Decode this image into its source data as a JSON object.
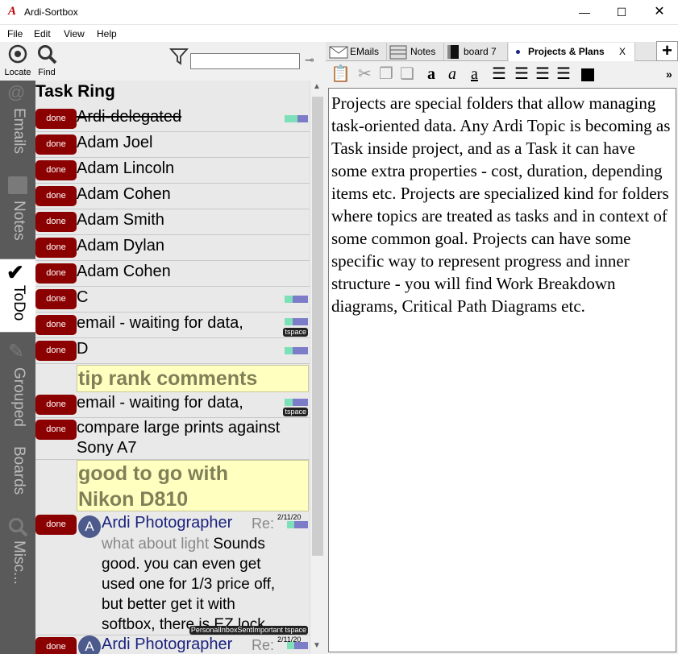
{
  "window": {
    "title": "Ardi-Sortbox",
    "minimize": "—",
    "maximize": "☐",
    "close": "✕"
  },
  "menu": [
    "File",
    "Edit",
    "View",
    "Help"
  ],
  "toolbar": {
    "locate": "Locate",
    "find": "Find",
    "filter_value": "",
    "pin": "⊸"
  },
  "side_tabs": [
    "Emails",
    "Notes",
    "ToDo",
    "Grouped",
    "Boards",
    "Misc..."
  ],
  "list": {
    "title": "Task Ring",
    "done_label": "done",
    "rows": [
      {
        "text": "Ardi-delegated",
        "progress": 0.55
      },
      {
        "text": "Adam Joel"
      },
      {
        "text": "Adam Lincoln"
      },
      {
        "text": "Adam Cohen"
      },
      {
        "text": "Adam Smith"
      },
      {
        "text": "Adam Dylan"
      },
      {
        "text": "Adam Cohen"
      },
      {
        "text": "C",
        "progress": 0.35
      },
      {
        "text": "email - waiting for data,",
        "progress": 0.35,
        "tag": "tspace"
      },
      {
        "text": "D",
        "progress": 0.35
      }
    ],
    "note1": "tip rank comments",
    "row_email2": {
      "text": "email - waiting for data,",
      "progress": 0.35,
      "tag": "tspace"
    },
    "row_compare": {
      "text1": "compare large prints against",
      "text2": "Sony A7"
    },
    "note2_line1": "good to go with",
    "note2_line2": "Nikon D810",
    "mail1": {
      "avatar": "A",
      "sender": "Ardi Photographer",
      "re": "Re:",
      "date": "2/11/20",
      "subject": "what about light",
      "body1": " Sounds",
      "body2": "good. you can even get",
      "body3": "used one for 1/3 price off,",
      "body4": "but better get it with",
      "body5": "softbox, there is EZ lock",
      "tags": "PersonalInboxSentImportant tspace"
    },
    "mail2": {
      "avatar": "A",
      "sender": "Ardi Photographer",
      "re": "Re:",
      "date": "2/11/20"
    }
  },
  "tabs": [
    {
      "label": "EMails",
      "icon": "envelope-icon"
    },
    {
      "label": "Notes",
      "icon": "notes-icon"
    },
    {
      "label": "board 7",
      "icon": "board-icon"
    },
    {
      "label": "Projects & Plans",
      "icon": "dot-icon",
      "close": "X",
      "active": true
    }
  ],
  "tab_add": "+",
  "format_toolbar": {
    "overflow": "»"
  },
  "editor": {
    "text": "Projects are special folders that allow managing task-oriented data. Any Ardi Topic is becoming as Task inside project, and as a Task it can have some extra properties - cost, duration, depending items etc. Projects are specialized kind for folders where topics are treated as tasks and in context of some common goal. Projects can have some specific way to represent progress and inner structure - you will find Work Breakdown diagrams, Critical Path Diagrams etc."
  },
  "colors": {
    "done": "#8b0000",
    "side_tabs_bg": "#5a5a5a",
    "note_bg": "#ffffc0",
    "sender": "#1a237e",
    "progress_fill": "#7ee0b8",
    "progress_bg": "#7c7cc8"
  }
}
